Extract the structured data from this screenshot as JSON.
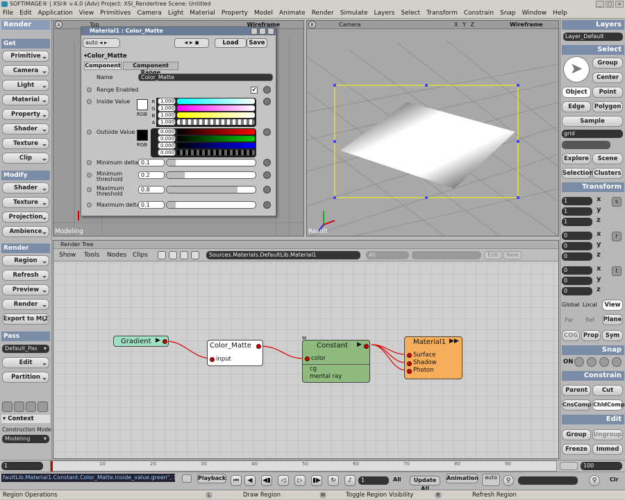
{
  "window": {
    "title": "SOFTIMAGE® | XSI® v.4.0 (Adv) Project: XSI_Rendertree    Scene: Untitled"
  },
  "menu": [
    "File",
    "Edit",
    "Application",
    "View",
    "Primitives",
    "Camera",
    "Light",
    "Material",
    "Property",
    "Model",
    "Animate",
    "Render",
    "Simulate",
    "Layers",
    "Select",
    "Transform",
    "Constrain",
    "Snap",
    "Window",
    "Help"
  ],
  "left_panel": {
    "title": "Render",
    "get_label": "Get",
    "get_items": [
      "Primitive",
      "Camera",
      "Light",
      "Material",
      "Property",
      "Shader",
      "Texture",
      "Clip"
    ],
    "modify_label": "Modify",
    "modify_items": [
      "Shader",
      "Texture",
      "Projection",
      "Ambience"
    ],
    "render_label": "Render",
    "render_items": [
      "Region",
      "Refresh",
      "Preview",
      "Render",
      "Export to MI2"
    ],
    "pass_label": "Pass",
    "pass_value": "Default_Pas",
    "pass_items": [
      "Edit",
      "Partition"
    ],
    "context_label": "Context",
    "construction_mode_label": "Construction Mode",
    "construction_mode_value": "Modeling"
  },
  "viewport_top": {
    "label_a": "A",
    "name": "Top",
    "mode": "Wireframe",
    "footer": "Modeling"
  },
  "viewport_cam": {
    "label_b": "B",
    "name": "Camera",
    "axes": "X Y Z",
    "mode": "Wireframe",
    "footer": "Result"
  },
  "property_editor": {
    "title": "Material1 : Color_Matte",
    "auto": "auto",
    "load": "Load",
    "save": "Save",
    "section": "Color_Matte",
    "tabs": [
      "Component",
      "Component Range"
    ],
    "name_label": "Name",
    "name_value": "Color_Matte",
    "range_enabled": "Range Enabled",
    "inside_value": "Inside Value",
    "outside_value": "Outside Value",
    "rgb_label": "RGB",
    "channels": [
      "R",
      "G",
      "B",
      "A"
    ],
    "inside_values": [
      "1.000",
      "1.000",
      "1.000",
      "1.000"
    ],
    "outside_values": [
      "0.000",
      "0.000",
      "0.000",
      "0.000"
    ],
    "min_delta_label": "Minimum delta",
    "min_delta": "0.1",
    "min_threshold_label": "Minimum threshold",
    "min_threshold": "0.2",
    "max_threshold_label": "Maximum threshold",
    "max_threshold": "0.8",
    "max_delta_label": "Maximum delta",
    "max_delta": "0.1"
  },
  "render_tree": {
    "title": "Render Tree",
    "toolbar": [
      "Show",
      "Tools",
      "Nodes",
      "Clips"
    ],
    "path": "Sources.Materials.DefaultLib.Material1",
    "filter": "All",
    "edit": "Edit",
    "new": "New",
    "nodes": {
      "gradient": {
        "title": "Gradient"
      },
      "color_matte": {
        "title": "Color_Matte",
        "port": "input"
      },
      "constant": {
        "title": "Constant",
        "ports": [
          "color",
          "cg",
          "mental ray"
        ],
        "tag": "M"
      },
      "material": {
        "title": "Material1",
        "ports": [
          "Surface",
          "Shadow",
          "Photon"
        ]
      }
    }
  },
  "right_panel": {
    "layers_label": "Layers",
    "layer_value": "Layer_Default",
    "select_label": "Select",
    "select_buttons": [
      "Group",
      "Center",
      "Object",
      "Point",
      "Edge",
      "Polygon",
      "Sample"
    ],
    "selected_button": "Object",
    "filter_value": "grid",
    "explore": "Explore",
    "scene": "Scene",
    "selection": "Selection",
    "clusters": "Clusters",
    "transform_label": "Transform",
    "scale_values": [
      "1",
      "1",
      "1"
    ],
    "rotate_values": [
      "0",
      "0",
      "0"
    ],
    "translate_values": [
      "0",
      "0",
      "0"
    ],
    "axes": [
      "x",
      "y",
      "z"
    ],
    "ref_modes": [
      "Global",
      "Local",
      "View",
      "Par",
      "Ref",
      "Plane"
    ],
    "cog": "COG",
    "prop": "Prop",
    "sym": "Sym",
    "snap_label": "Snap",
    "snap_on": "ON",
    "constrain_label": "Constrain",
    "parent": "Parent",
    "cut": "Cut",
    "cnscomp": "CnsComp",
    "chldcomp": "ChldComp",
    "edit_label": "Edit",
    "group": "Group",
    "ungroup": "Ungroup",
    "freeze": "Freeze",
    "immed": "Immed"
  },
  "timeline": {
    "start": "1",
    "end": "100",
    "ticks": [
      "10",
      "20",
      "30",
      "40",
      "50",
      "60",
      "70",
      "80",
      "90"
    ]
  },
  "playbar": {
    "script_line": "faultLib.Material1.Constant.Color_Matte.inside_value.green\", 1",
    "playback": "Playback",
    "frame": "1",
    "all": "All",
    "update_all": "Update All",
    "animation": "Animation",
    "auto": "auto",
    "clr": "Clr"
  },
  "status": {
    "left": "Region Operations",
    "l_label": "L",
    "l_action": "Draw Region",
    "m_label": "M",
    "m_action": "Toggle Region Visibility",
    "r_label": "R",
    "r_action": "Refresh Region"
  }
}
